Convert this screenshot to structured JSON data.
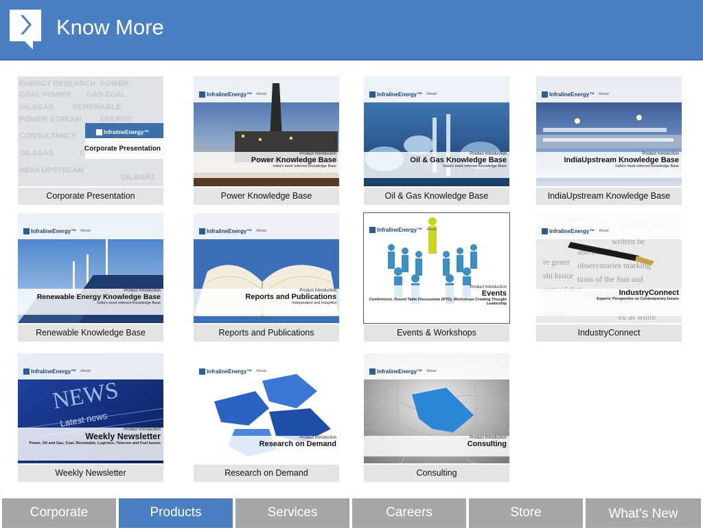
{
  "header": {
    "title": "Know More"
  },
  "brand": {
    "name": "InfralineEnergy™",
    "tagline": "Ahead"
  },
  "tiles": [
    {
      "caption": "Corporate Presentation",
      "band_title": "Corporate Presentation",
      "band_tag": "",
      "band_sub": ""
    },
    {
      "caption": "Power Knowledge Base",
      "band_title": "Power Knowledge Base",
      "band_tag": "Product Introduction",
      "band_sub": "India's most referred Knowledge Base"
    },
    {
      "caption": "Oil & Gas Knowledge Base",
      "band_title": "Oil & Gas Knowledge Base",
      "band_tag": "Product Introduction",
      "band_sub": "India's most referred Knowledge Base"
    },
    {
      "caption": "IndiaUpstream Knowledge Base",
      "band_title": "IndiaUpstream Knowledge Base",
      "band_tag": "Product Introduction",
      "band_sub": "India's most referred Knowledge Base"
    },
    {
      "caption": "Renewable Knowledge Base",
      "band_title": "Renewable Energy Knowledge Base",
      "band_tag": "Product Introduction",
      "band_sub": "India's most referred Knowledge Base"
    },
    {
      "caption": "Reports and Publications",
      "band_title": "Reports and Publications",
      "band_tag": "Product Introduction",
      "band_sub": "Independent and Insightful"
    },
    {
      "caption": "Events & Workshops",
      "band_title": "Events",
      "band_tag": "Product Introduction",
      "band_sub": "Conferences, Round Table Discussions (RTD), Workshops Creating Thought Leadership"
    },
    {
      "caption": "IndustryConnect",
      "band_title": "IndustryConnect",
      "band_tag": "",
      "band_sub": "Experts' Perspective on Contemporary Issues"
    },
    {
      "caption": "Weekly Newsletter",
      "band_title": "Weekly Newsletter",
      "band_tag": "Product Introduction",
      "band_sub": "Power, Oil and Gas, Coal, Renewable, Logistics, Telecom and Fuel Issues"
    },
    {
      "caption": "Research on Demand",
      "band_title": "Research on Demand",
      "band_tag": "Product Introduction",
      "band_sub": ""
    },
    {
      "caption": "Consulting",
      "band_title": "Consulting",
      "band_tag": "Product Introduction",
      "band_sub": ""
    }
  ],
  "nav": [
    {
      "label": "Corporate"
    },
    {
      "label": "Products",
      "active": true
    },
    {
      "label": "Services"
    },
    {
      "label": "Careers"
    },
    {
      "label": "Store"
    },
    {
      "label": "What’s New"
    }
  ],
  "colors": {
    "header": "#4a7fc1",
    "nav_active": "#4a7fc1",
    "nav_inactive": "#a6a6a6",
    "caption_bg": "#e4e4e4"
  }
}
